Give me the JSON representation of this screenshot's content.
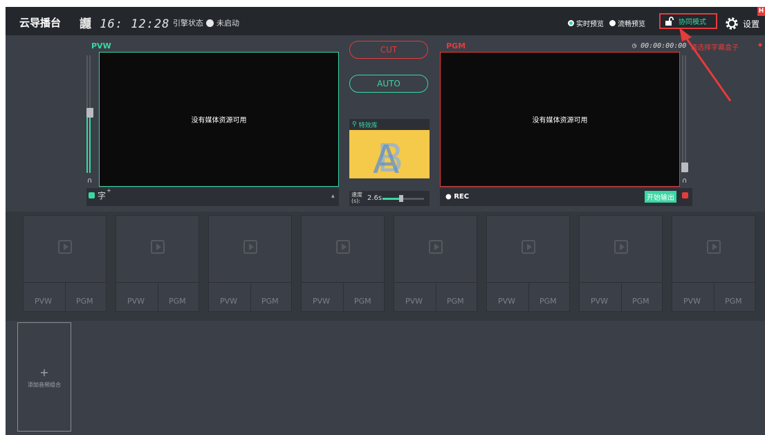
{
  "topbar": {
    "title": "云导播台",
    "clock_prefix": "讔",
    "clock": "16: 12:28",
    "engine_label": "引擎状态",
    "engine_status": "未启动",
    "preview_realtime": "实时预览",
    "preview_smooth": "流畅预览",
    "collab_mode": "协同模式",
    "settings": "设置",
    "badge": "H"
  },
  "pvw": {
    "label": "PVW",
    "screen_text": "没有媒体资源可用",
    "subtitle_icon_text": "字",
    "caret": "▲"
  },
  "center": {
    "cut_label": "CUT",
    "auto_label": "AUTO",
    "effects_label": "特效库",
    "speed_label_line1": "速度",
    "speed_label_line2": "(s):",
    "speed_value": "2.6s",
    "speed_fraction": 0.45
  },
  "pgm": {
    "label": "PGM",
    "timecode": "00:00:00:00",
    "subtitle_select": "请选择字幕盒子",
    "screen_text": "没有媒体资源可用",
    "rec_label": "REC",
    "start_output": "开始输出"
  },
  "tiles": [
    {
      "pvw": "PVW",
      "pgm": "PGM"
    },
    {
      "pvw": "PVW",
      "pgm": "PGM"
    },
    {
      "pvw": "PVW",
      "pgm": "PGM"
    },
    {
      "pvw": "PVW",
      "pgm": "PGM"
    },
    {
      "pvw": "PVW",
      "pgm": "PGM"
    },
    {
      "pvw": "PVW",
      "pgm": "PGM"
    },
    {
      "pvw": "PVW",
      "pgm": "PGM"
    },
    {
      "pvw": "PVW",
      "pgm": "PGM"
    }
  ],
  "audio": {
    "plus": "+",
    "add_label": "添加音频组合"
  },
  "colors": {
    "accent_green": "#3ad7a5",
    "accent_red": "#e53b3b",
    "background": "#3b3f47",
    "topbar": "#24272c"
  }
}
